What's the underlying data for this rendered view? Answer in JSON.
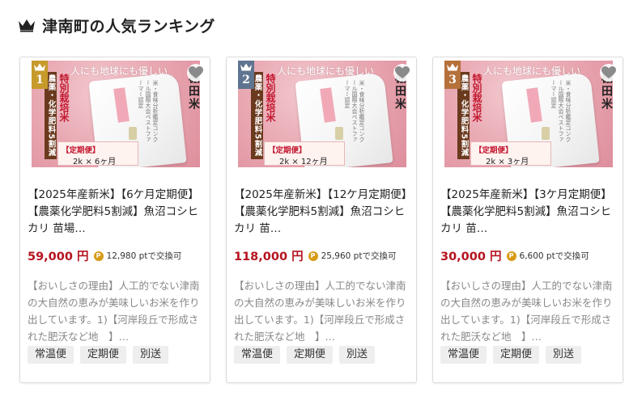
{
  "section": {
    "title": "津南町の人気ランキング",
    "icon": "crown-icon"
  },
  "colors": {
    "rank_1": "#c69a2b",
    "rank_2": "#5f7490",
    "rank_3": "#b5713a",
    "price": "#b5141f",
    "point_badge": "#d89b16"
  },
  "thumbnail": {
    "headline": "人にも地球にも優しい",
    "side_banner": "農薬・化学肥料5割減",
    "special": "特別栽培米",
    "brand": "棚田米",
    "plan_label": "【定期便】",
    "bag_text": "米・食味分析鑑定コンクール国際大会ベストファーマー認定"
  },
  "products": [
    {
      "rank": "1",
      "plan_detail": "2k × 6ヶ月",
      "title": "【2025年産新米】【6ケ月定期便】【農薬化学肥料5割減】魚沼コシヒカリ 苗場…",
      "price": "59,000 円",
      "point_icon": "P",
      "points": "12,980 ptで交換可",
      "description": "【おいしさの理由】人工的でない津南の大自然の恵みが美味しいお米を作り出しています。1)【河岸段丘で形成された肥沃など地　】…",
      "tags": [
        "常温便",
        "定期便",
        "別送"
      ]
    },
    {
      "rank": "2",
      "plan_detail": "2k × 12ヶ月",
      "title": "【2025年産新米】【12ケ月定期便】【農薬化学肥料5割減】魚沼コシヒカリ 苗…",
      "price": "118,000 円",
      "point_icon": "P",
      "points": "25,960 ptで交換可",
      "description": "【おいしさの理由】人工的でない津南の大自然の恵みが美味しいお米を作り出しています。1)【河岸段丘で形成された肥沃など地　】…",
      "tags": [
        "常温便",
        "定期便",
        "別送"
      ]
    },
    {
      "rank": "3",
      "plan_detail": "2k × 3ヶ月",
      "title": "【2025年産新米】【3ケ月定期便】【農薬化学肥料5割減】魚沼コシヒカリ 苗…",
      "price": "30,000 円",
      "point_icon": "P",
      "points": "6,600 ptで交換可",
      "description": "【おいしさの理由】人工的でない津南の大自然の恵みが美味しいお米を作り出しています。1)【河岸段丘で形成された肥沃など地　】…",
      "tags": [
        "常温便",
        "定期便",
        "別送"
      ]
    }
  ]
}
